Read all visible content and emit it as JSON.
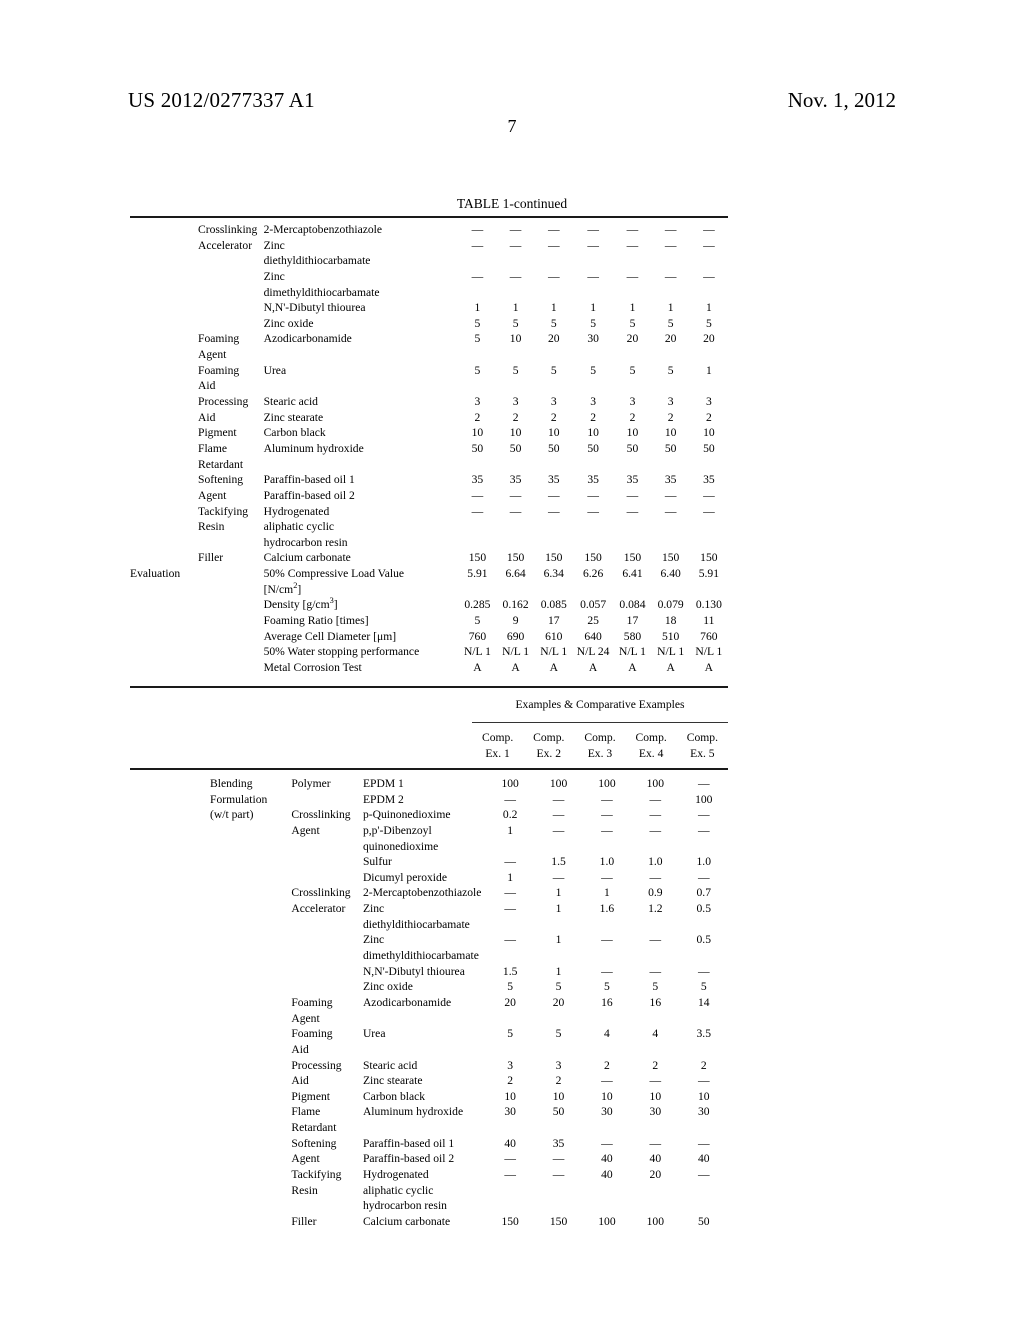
{
  "header": {
    "publication_number": "US 2012/0277337 A1",
    "publication_date": "Nov. 1, 2012",
    "page_number": "7"
  },
  "table_caption": "TABLE 1-continued",
  "table1": {
    "rows": [
      {
        "group": "Crosslinking",
        "cat": "",
        "item": "2-Mercaptobenzothiazole",
        "values": [
          "—",
          "—",
          "—",
          "—",
          "—",
          "—",
          "—"
        ]
      },
      {
        "group": "Accelerator",
        "cat": "",
        "item": "Zinc",
        "values": [
          "—",
          "—",
          "—",
          "—",
          "—",
          "—",
          "—"
        ]
      },
      {
        "group": "",
        "cat": "",
        "item": "diethyldithiocarbamate",
        "values": [
          "",
          "",
          "",
          "",
          "",
          "",
          ""
        ]
      },
      {
        "group": "",
        "cat": "",
        "item": "Zinc",
        "values": [
          "—",
          "—",
          "—",
          "—",
          "—",
          "—",
          "—"
        ]
      },
      {
        "group": "",
        "cat": "",
        "item": "dimethyldithiocarbamate",
        "values": [
          "",
          "",
          "",
          "",
          "",
          "",
          ""
        ]
      },
      {
        "group": "",
        "cat": "",
        "item": "N,N'-Dibutyl thiourea",
        "values": [
          "1",
          "1",
          "1",
          "1",
          "1",
          "1",
          "1"
        ]
      },
      {
        "group": "",
        "cat": "",
        "item": "Zinc oxide",
        "values": [
          "5",
          "5",
          "5",
          "5",
          "5",
          "5",
          "5"
        ]
      },
      {
        "group": "Foaming",
        "cat": "",
        "item": "Azodicarbonamide",
        "values": [
          "5",
          "10",
          "20",
          "30",
          "20",
          "20",
          "20"
        ]
      },
      {
        "group": "Agent",
        "cat": "",
        "item": "",
        "values": [
          "",
          "",
          "",
          "",
          "",
          "",
          ""
        ]
      },
      {
        "group": "Foaming",
        "cat": "",
        "item": "Urea",
        "values": [
          "5",
          "5",
          "5",
          "5",
          "5",
          "5",
          "1"
        ]
      },
      {
        "group": "Aid",
        "cat": "",
        "item": "",
        "values": [
          "",
          "",
          "",
          "",
          "",
          "",
          ""
        ]
      },
      {
        "group": "Processing",
        "cat": "",
        "item": "Stearic acid",
        "values": [
          "3",
          "3",
          "3",
          "3",
          "3",
          "3",
          "3"
        ]
      },
      {
        "group": "Aid",
        "cat": "",
        "item": "Zinc stearate",
        "values": [
          "2",
          "2",
          "2",
          "2",
          "2",
          "2",
          "2"
        ]
      },
      {
        "group": "Pigment",
        "cat": "",
        "item": "Carbon black",
        "values": [
          "10",
          "10",
          "10",
          "10",
          "10",
          "10",
          "10"
        ]
      },
      {
        "group": "Flame",
        "cat": "",
        "item": "Aluminum hydroxide",
        "values": [
          "50",
          "50",
          "50",
          "50",
          "50",
          "50",
          "50"
        ]
      },
      {
        "group": "Retardant",
        "cat": "",
        "item": "",
        "values": [
          "",
          "",
          "",
          "",
          "",
          "",
          ""
        ]
      },
      {
        "group": "Softening",
        "cat": "",
        "item": "Paraffin-based oil 1",
        "values": [
          "35",
          "35",
          "35",
          "35",
          "35",
          "35",
          "35"
        ]
      },
      {
        "group": "Agent",
        "cat": "",
        "item": "Paraffin-based oil 2",
        "values": [
          "—",
          "—",
          "—",
          "—",
          "—",
          "—",
          "—"
        ]
      },
      {
        "group": "Tackifying",
        "cat": "",
        "item": "Hydrogenated",
        "values": [
          "—",
          "—",
          "—",
          "—",
          "—",
          "—",
          "—"
        ]
      },
      {
        "group": "Resin",
        "cat": "",
        "item": "aliphatic cyclic",
        "values": [
          "",
          "",
          "",
          "",
          "",
          "",
          ""
        ]
      },
      {
        "group": "",
        "cat": "",
        "item": "hydrocarbon resin",
        "values": [
          "",
          "",
          "",
          "",
          "",
          "",
          ""
        ]
      },
      {
        "group": "Filler",
        "cat": "",
        "item": "Calcium carbonate",
        "values": [
          "150",
          "150",
          "150",
          "150",
          "150",
          "150",
          "150"
        ]
      }
    ],
    "evaluation_label": "Evaluation",
    "eval_rows": [
      {
        "item": "50% Compressive Load Value",
        "values": [
          "5.91",
          "6.64",
          "6.34",
          "6.26",
          "6.41",
          "6.40",
          "5.91"
        ]
      },
      {
        "item": "[N/cm2]",
        "item_base": "[N/cm",
        "item_sup": "2",
        "item_tail": "]",
        "values": [
          "",
          "",
          "",
          "",
          "",
          "",
          ""
        ]
      },
      {
        "item": "Density [g/cm3]",
        "item_base": "Density [g/cm",
        "item_sup": "3",
        "item_tail": "]",
        "values": [
          "0.285",
          "0.162",
          "0.085",
          "0.057",
          "0.084",
          "0.079",
          "0.130"
        ]
      },
      {
        "item": "Foaming Ratio [times]",
        "values": [
          "5",
          "9",
          "17",
          "25",
          "17",
          "18",
          "11"
        ]
      },
      {
        "item": "Average Cell Diameter [μm]",
        "values": [
          "760",
          "690",
          "610",
          "640",
          "580",
          "510",
          "760"
        ]
      },
      {
        "item": "50% Water stopping performance",
        "values": [
          "N/L 1",
          "N/L 1",
          "N/L 1",
          "N/L 24",
          "N/L 1",
          "N/L 1",
          "N/L 1"
        ]
      },
      {
        "item": "Metal Corrosion Test",
        "values": [
          "A",
          "A",
          "A",
          "A",
          "A",
          "A",
          "A"
        ]
      }
    ]
  },
  "table2": {
    "span_header": "Examples & Comparative Examples",
    "column_headers": [
      {
        "line1": "Comp.",
        "line2": "Ex. 1"
      },
      {
        "line1": "Comp.",
        "line2": "Ex. 2"
      },
      {
        "line1": "Comp.",
        "line2": "Ex. 3"
      },
      {
        "line1": "Comp.",
        "line2": "Ex. 4"
      },
      {
        "line1": "Comp.",
        "line2": "Ex. 5"
      }
    ],
    "rows": [
      {
        "group": "Blending",
        "cat": "Polymer",
        "item": "EPDM 1",
        "values": [
          "100",
          "100",
          "100",
          "100",
          "—"
        ]
      },
      {
        "group": "Formulation",
        "cat": "",
        "item": "EPDM 2",
        "values": [
          "—",
          "—",
          "—",
          "—",
          "100"
        ]
      },
      {
        "group": "(w/t part)",
        "cat": "Crosslinking",
        "item": "p-Quinonedioxime",
        "values": [
          "0.2",
          "—",
          "—",
          "—",
          "—"
        ]
      },
      {
        "group": "",
        "cat": "Agent",
        "item": "p,p'-Dibenzoyl",
        "values": [
          "1",
          "—",
          "—",
          "—",
          "—"
        ]
      },
      {
        "group": "",
        "cat": "",
        "item": "quinonedioxime",
        "values": [
          "",
          "",
          "",
          "",
          ""
        ]
      },
      {
        "group": "",
        "cat": "",
        "item": "Sulfur",
        "values": [
          "—",
          "1.5",
          "1.0",
          "1.0",
          "1.0"
        ]
      },
      {
        "group": "",
        "cat": "",
        "item": "Dicumyl peroxide",
        "values": [
          "1",
          "—",
          "—",
          "—",
          "—"
        ]
      },
      {
        "group": "",
        "cat": "Crosslinking",
        "item": "2-Mercaptobenzothiazole",
        "values": [
          "—",
          "1",
          "1",
          "0.9",
          "0.7"
        ]
      },
      {
        "group": "",
        "cat": "Accelerator",
        "item": "Zinc",
        "values": [
          "—",
          "1",
          "1.6",
          "1.2",
          "0.5"
        ]
      },
      {
        "group": "",
        "cat": "",
        "item": "diethyldithiocarbamate",
        "values": [
          "",
          "",
          "",
          "",
          ""
        ]
      },
      {
        "group": "",
        "cat": "",
        "item": "Zinc",
        "values": [
          "—",
          "1",
          "—",
          "—",
          "0.5"
        ]
      },
      {
        "group": "",
        "cat": "",
        "item": "dimethyldithiocarbamate",
        "values": [
          "",
          "",
          "",
          "",
          ""
        ]
      },
      {
        "group": "",
        "cat": "",
        "item": "N,N'-Dibutyl thiourea",
        "values": [
          "1.5",
          "1",
          "—",
          "—",
          "—"
        ]
      },
      {
        "group": "",
        "cat": "",
        "item": "Zinc oxide",
        "values": [
          "5",
          "5",
          "5",
          "5",
          "5"
        ]
      },
      {
        "group": "",
        "cat": "Foaming",
        "item": "Azodicarbonamide",
        "values": [
          "20",
          "20",
          "16",
          "16",
          "14"
        ]
      },
      {
        "group": "",
        "cat": "Agent",
        "item": "",
        "values": [
          "",
          "",
          "",
          "",
          ""
        ]
      },
      {
        "group": "",
        "cat": "Foaming",
        "item": "Urea",
        "values": [
          "5",
          "5",
          "4",
          "4",
          "3.5"
        ]
      },
      {
        "group": "",
        "cat": "Aid",
        "item": "",
        "values": [
          "",
          "",
          "",
          "",
          ""
        ]
      },
      {
        "group": "",
        "cat": "Processing",
        "item": "Stearic acid",
        "values": [
          "3",
          "3",
          "2",
          "2",
          "2"
        ]
      },
      {
        "group": "",
        "cat": "Aid",
        "item": "Zinc stearate",
        "values": [
          "2",
          "2",
          "—",
          "—",
          "—"
        ]
      },
      {
        "group": "",
        "cat": "Pigment",
        "item": "Carbon black",
        "values": [
          "10",
          "10",
          "10",
          "10",
          "10"
        ]
      },
      {
        "group": "",
        "cat": "Flame",
        "item": "Aluminum hydroxide",
        "values": [
          "30",
          "50",
          "30",
          "30",
          "30"
        ]
      },
      {
        "group": "",
        "cat": "Retardant",
        "item": "",
        "values": [
          "",
          "",
          "",
          "",
          ""
        ]
      },
      {
        "group": "",
        "cat": "Softening",
        "item": "Paraffin-based oil 1",
        "values": [
          "40",
          "35",
          "—",
          "—",
          "—"
        ]
      },
      {
        "group": "",
        "cat": "Agent",
        "item": "Paraffin-based oil 2",
        "values": [
          "—",
          "—",
          "40",
          "40",
          "40"
        ]
      },
      {
        "group": "",
        "cat": "Tackifying",
        "item": "Hydrogenated",
        "values": [
          "—",
          "—",
          "40",
          "20",
          "—"
        ]
      },
      {
        "group": "",
        "cat": "Resin",
        "item": "aliphatic cyclic",
        "values": [
          "",
          "",
          "",
          "",
          ""
        ]
      },
      {
        "group": "",
        "cat": "",
        "item": "hydrocarbon resin",
        "values": [
          "",
          "",
          "",
          "",
          ""
        ]
      },
      {
        "group": "",
        "cat": "Filler",
        "item": "Calcium carbonate",
        "values": [
          "150",
          "150",
          "100",
          "100",
          "50"
        ]
      }
    ]
  }
}
